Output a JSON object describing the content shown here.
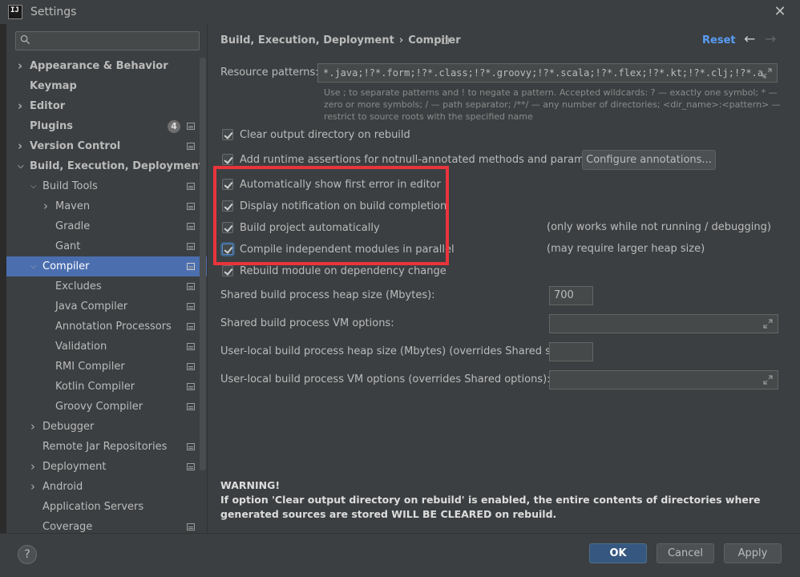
{
  "window": {
    "title": "Settings",
    "app_icon_text": "IJ"
  },
  "sidebar": {
    "search_placeholder": "",
    "items": [
      {
        "label": "Appearance & Behavior",
        "bold": true,
        "expander": "collapsed",
        "indent": 0,
        "page_icon": false
      },
      {
        "label": "Keymap",
        "bold": true,
        "expander": "none",
        "indent": 0,
        "page_icon": false
      },
      {
        "label": "Editor",
        "bold": true,
        "expander": "collapsed",
        "indent": 0,
        "page_icon": false
      },
      {
        "label": "Plugins",
        "bold": true,
        "expander": "none",
        "indent": 0,
        "page_icon": true,
        "badge": "4"
      },
      {
        "label": "Version Control",
        "bold": true,
        "expander": "collapsed",
        "indent": 0,
        "page_icon": true
      },
      {
        "label": "Build, Execution, Deployment",
        "bold": true,
        "expander": "expanded",
        "indent": 0,
        "page_icon": false
      },
      {
        "label": "Build Tools",
        "bold": false,
        "expander": "expanded",
        "indent": 1,
        "page_icon": true
      },
      {
        "label": "Maven",
        "bold": false,
        "expander": "collapsed",
        "indent": 2,
        "page_icon": true
      },
      {
        "label": "Gradle",
        "bold": false,
        "expander": "none",
        "indent": 2,
        "page_icon": true
      },
      {
        "label": "Gant",
        "bold": false,
        "expander": "none",
        "indent": 2,
        "page_icon": true
      },
      {
        "label": "Compiler",
        "bold": false,
        "expander": "expanded",
        "indent": 1,
        "page_icon": true,
        "selected": true
      },
      {
        "label": "Excludes",
        "bold": false,
        "expander": "none",
        "indent": 2,
        "page_icon": true
      },
      {
        "label": "Java Compiler",
        "bold": false,
        "expander": "none",
        "indent": 2,
        "page_icon": true
      },
      {
        "label": "Annotation Processors",
        "bold": false,
        "expander": "none",
        "indent": 2,
        "page_icon": true
      },
      {
        "label": "Validation",
        "bold": false,
        "expander": "none",
        "indent": 2,
        "page_icon": true
      },
      {
        "label": "RMI Compiler",
        "bold": false,
        "expander": "none",
        "indent": 2,
        "page_icon": true
      },
      {
        "label": "Kotlin Compiler",
        "bold": false,
        "expander": "none",
        "indent": 2,
        "page_icon": true
      },
      {
        "label": "Groovy Compiler",
        "bold": false,
        "expander": "none",
        "indent": 2,
        "page_icon": true
      },
      {
        "label": "Debugger",
        "bold": false,
        "expander": "collapsed",
        "indent": 1,
        "page_icon": false
      },
      {
        "label": "Remote Jar Repositories",
        "bold": false,
        "expander": "none",
        "indent": 1,
        "page_icon": true
      },
      {
        "label": "Deployment",
        "bold": false,
        "expander": "collapsed",
        "indent": 1,
        "page_icon": true
      },
      {
        "label": "Android",
        "bold": false,
        "expander": "collapsed",
        "indent": 1,
        "page_icon": false
      },
      {
        "label": "Application Servers",
        "bold": false,
        "expander": "none",
        "indent": 1,
        "page_icon": false
      },
      {
        "label": "Coverage",
        "bold": false,
        "expander": "none",
        "indent": 1,
        "page_icon": true
      }
    ]
  },
  "header": {
    "breadcrumb_parent": "Build, Execution, Deployment",
    "breadcrumb_sep": "›",
    "breadcrumb_current": "Compiler",
    "reset_label": "Reset",
    "back_glyph": "←",
    "forward_glyph": "→"
  },
  "resource": {
    "label": "Resource patterns:",
    "value": "*.java;!?*.form;!?*.class;!?*.groovy;!?*.scala;!?*.flex;!?*.kt;!?*.clj;!?*.aj",
    "hint": "Use ; to separate patterns and ! to negate a pattern. Accepted wildcards: ? — exactly one symbol; * — zero or more symbols; / — path separator; /**/ — any number of directories; <dir_name>:<pattern> — restrict to source roots with the specified name"
  },
  "options": {
    "clear_output": {
      "label": "Clear output directory on rebuild",
      "checked": true
    },
    "runtime_assertions": {
      "label": "Add runtime assertions for notnull-annotated methods and parameters",
      "checked": true
    },
    "configure_annotations_label": "Configure annotations...",
    "show_first_error": {
      "label": "Automatically show first error in editor",
      "checked": true
    },
    "build_notification": {
      "label": "Display notification on build completion",
      "checked": true
    },
    "build_auto": {
      "label": "Build project automatically",
      "checked": true,
      "note": "(only works while not running / debugging)"
    },
    "parallel": {
      "label": "Compile independent modules in parallel",
      "checked": true,
      "note": "(may require larger heap size)"
    },
    "rebuild_dependency": {
      "label": "Rebuild module on dependency change",
      "checked": true
    }
  },
  "process": {
    "heap_label": "Shared build process heap size (Mbytes):",
    "heap_value": "700",
    "vm_label": "Shared build process VM options:",
    "vm_value": "",
    "user_heap_label": "User-local build process heap size (Mbytes) (overrides Shared size):",
    "user_heap_value": "",
    "user_vm_label": "User-local build process VM options (overrides Shared options):",
    "user_vm_value": ""
  },
  "warning": {
    "title": "WARNING!",
    "text": "If option 'Clear output directory on rebuild' is enabled, the entire contents of directories where generated sources are stored WILL BE CLEARED on rebuild."
  },
  "footer": {
    "help_label": "?",
    "ok_label": "OK",
    "cancel_label": "Cancel",
    "apply_label": "Apply"
  },
  "colors": {
    "selection": "#4b6eaf",
    "highlight_box": "#e9343c",
    "link": "#589df6",
    "background": "#3c3f41"
  }
}
